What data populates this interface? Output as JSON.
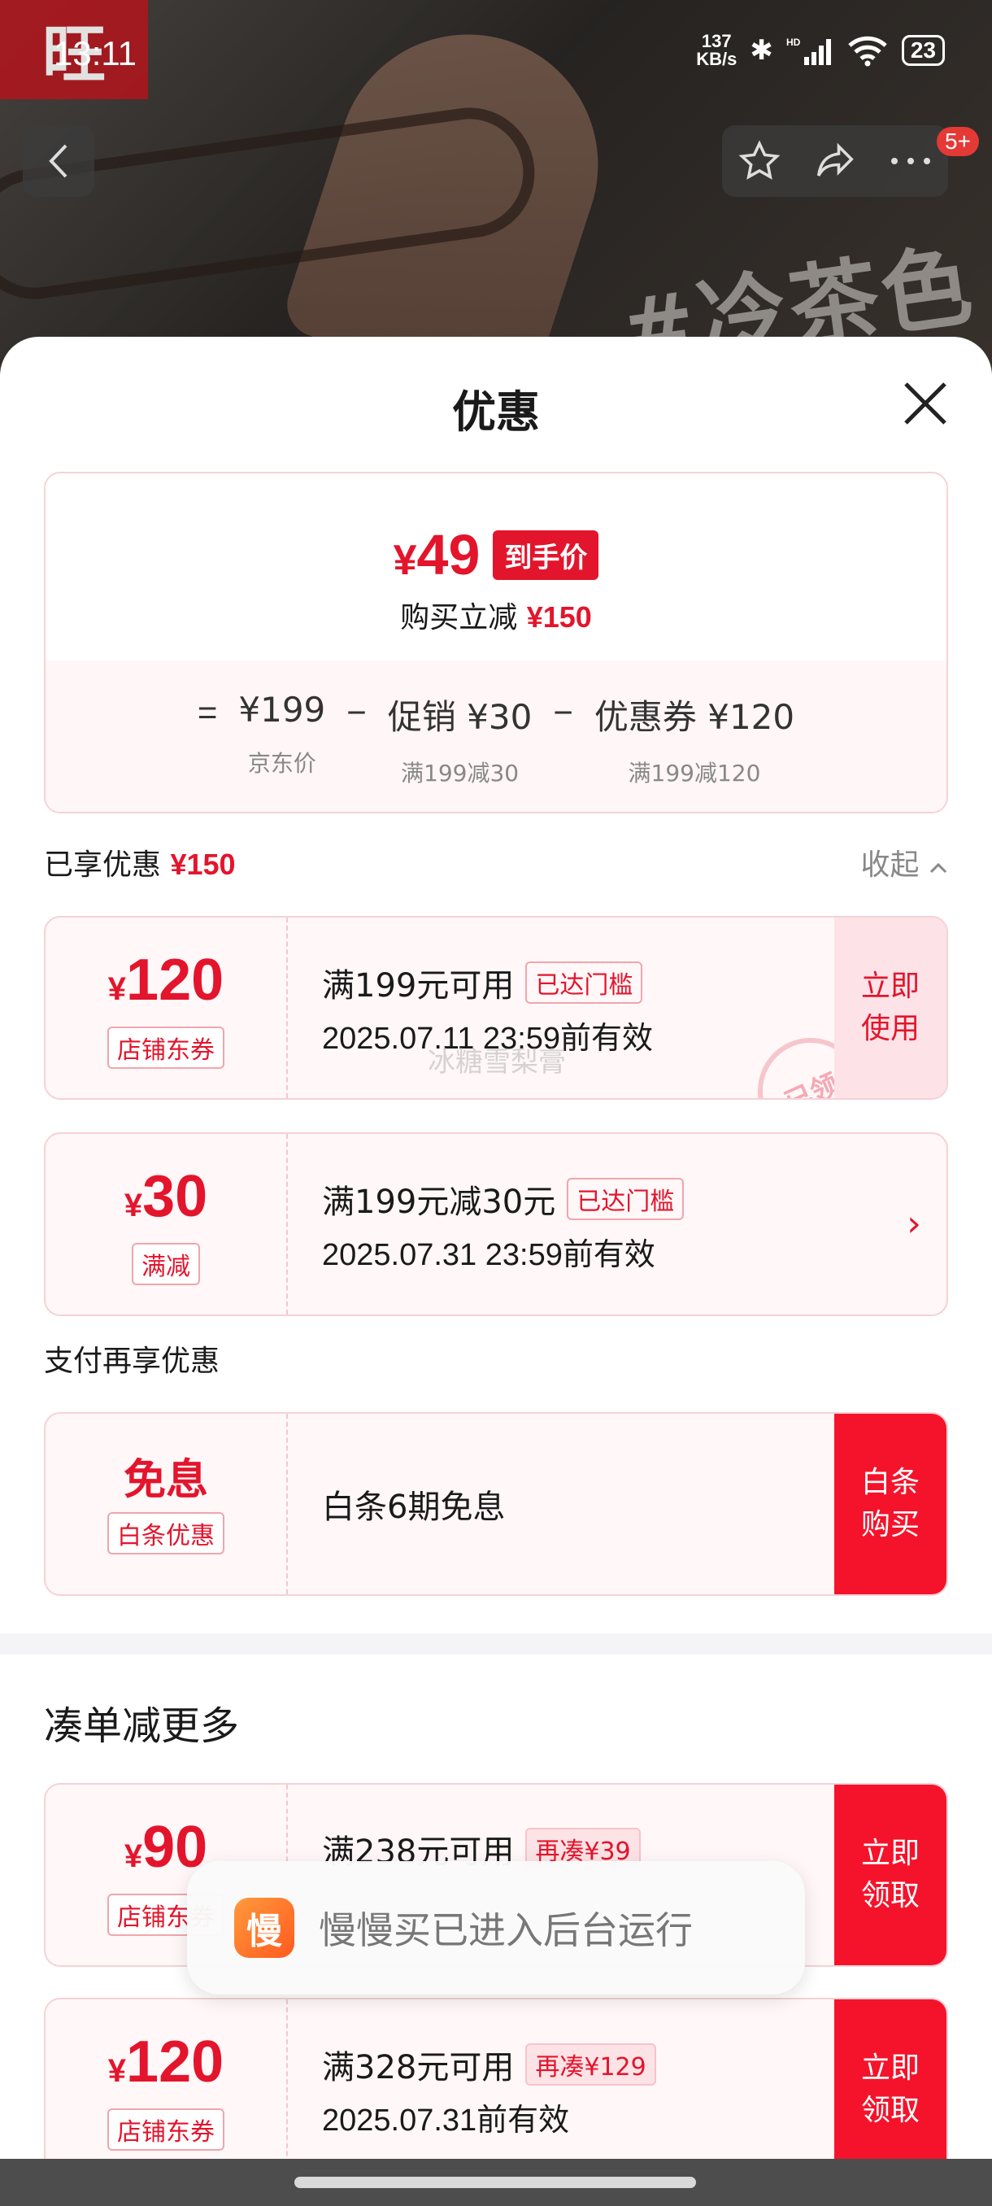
{
  "status_bar": {
    "time": "13:11",
    "net_speed_value": "137",
    "net_speed_unit": "KB/s",
    "battery": "23"
  },
  "background": {
    "logo_text": "旺",
    "tag_text": "#冷茶色",
    "nav_badge": "5+"
  },
  "sheet": {
    "title": "优惠",
    "summary": {
      "final_price": "49",
      "currency": "¥",
      "price_tag": "到手价",
      "saving_label": "购买立减",
      "saving_value": "¥150",
      "calc": [
        {
          "op": "=",
          "value": "¥199",
          "sub": "京东价"
        },
        {
          "op": "−",
          "value": "促销 ¥30",
          "sub": "满199减30"
        },
        {
          "op": "−",
          "value": "优惠券 ¥120",
          "sub": "满199减120"
        }
      ]
    },
    "enjoyed": {
      "label": "已享优惠",
      "value": "¥150",
      "collapse": "收起"
    },
    "enjoyed_coupons": [
      {
        "currency": "¥",
        "amount": "120",
        "type": "店铺东券",
        "condition": "满199元可用",
        "badge": "已达门槛",
        "expiry": "2025.07.11 23:59前有效",
        "action": "立即使用",
        "stamp": "已领",
        "watermark": "冰糖雪梨膏"
      },
      {
        "currency": "¥",
        "amount": "30",
        "type": "满减",
        "condition": "满199元减30元",
        "badge": "已达门槛",
        "expiry": "2025.07.31 23:59前有效",
        "action": "›"
      }
    ],
    "pay_section": {
      "label": "支付再享优惠",
      "card": {
        "amount": "免息",
        "type": "白条优惠",
        "condition": "白条6期免息",
        "action": "白条购买"
      }
    },
    "more_section": {
      "heading": "凑单减更多",
      "coupons": [
        {
          "currency": "¥",
          "amount": "90",
          "type": "店铺东券",
          "condition": "满238元可用",
          "badge": "再凑¥39",
          "action": "立即领取"
        },
        {
          "currency": "¥",
          "amount": "120",
          "type": "店铺东券",
          "condition": "满328元可用",
          "badge": "再凑¥129",
          "expiry": "2025.07.31前有效",
          "action": "立即领取"
        }
      ]
    }
  },
  "toast": {
    "icon_text": "慢",
    "message": "慢慢买已进入后台运行"
  },
  "colors": {
    "accent_red": "#e3152c",
    "button_red": "#f5132b",
    "card_bg": "#fff7f8"
  }
}
